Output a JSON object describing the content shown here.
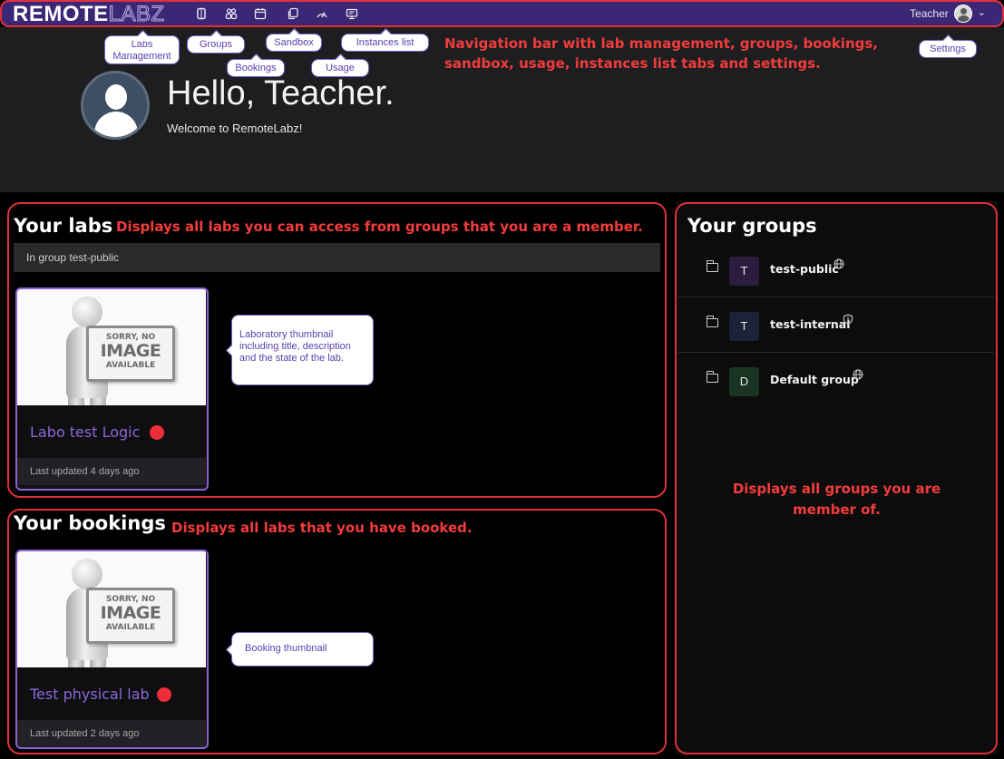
{
  "navbar": {
    "logo_main": "REMOTE",
    "logo_accent": "LABZ",
    "icons": [
      "labs-management-icon",
      "groups-icon",
      "bookings-icon",
      "sandbox-icon",
      "usage-icon",
      "instances-list-icon"
    ],
    "user_name": "Teacher",
    "user_chevron": "⌄"
  },
  "callouts": {
    "labs_management": "Labs\nManagement",
    "groups": "Groups",
    "bookings": "Bookings",
    "sandbox": "Sandbox",
    "usage": "Usage",
    "instances_list": "Instances list",
    "settings": "Settings",
    "lab_thumbnail": "Laboratory thumbnail including title, description and the state of the lab.",
    "booking_thumbnail": "Booking thumbnail"
  },
  "annotations": {
    "navbar": "Navigation bar with lab management, groups, bookings, sandbox, usage, instances list tabs and settings.",
    "labs": "Displays all labs you can access from groups that you are a member.",
    "bookings": "Displays all labs that you have booked.",
    "groups": "Displays all groups you are member of."
  },
  "hero": {
    "title": "Hello, Teacher.",
    "subtitle": "Welcome to RemoteLabz!"
  },
  "labs": {
    "title": "Your labs",
    "group_label": "In group test-public",
    "card": {
      "placeholder": {
        "line1": "SORRY, NO",
        "line2": "IMAGE",
        "line3": "AVAILABLE"
      },
      "title": "Labo test Logic",
      "status_color": "#ee2d3a",
      "updated": "Last updated 4 days ago"
    }
  },
  "bookings": {
    "title": "Your bookings",
    "card": {
      "placeholder": {
        "line1": "SORRY, NO",
        "line2": "IMAGE",
        "line3": "AVAILABLE"
      },
      "title": "Test physical lab",
      "status_color": "#ee2d3a",
      "updated": "Last updated 2 days ago"
    }
  },
  "groups": {
    "title": "Your groups",
    "items": [
      {
        "initial": "T",
        "name": "test-public",
        "visibility_icon": "globe-icon",
        "badge_color": "#2c1d3e"
      },
      {
        "initial": "T",
        "name": "test-internal",
        "visibility_icon": "shield-icon",
        "badge_color": "#1c2238"
      },
      {
        "initial": "D",
        "name": "Default group",
        "visibility_icon": "globe-icon",
        "badge_color": "#1a3423"
      }
    ]
  },
  "colors": {
    "navbar": "#3b2775",
    "annotation_red": "#f23c3c",
    "card_border": "#8a63d2",
    "title_purple": "#8b68d8"
  }
}
